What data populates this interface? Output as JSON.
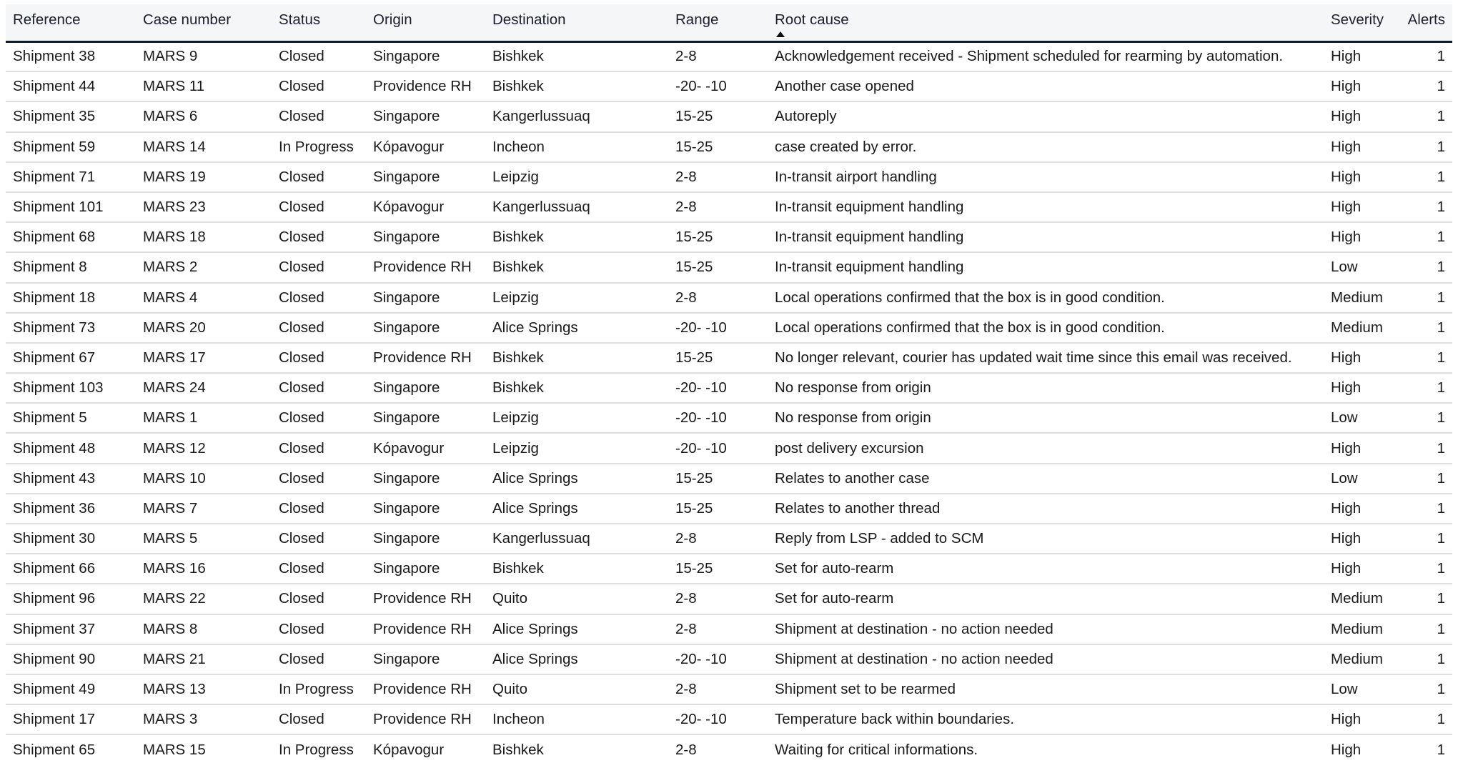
{
  "table": {
    "columns": [
      {
        "key": "reference",
        "label": "Reference"
      },
      {
        "key": "case_number",
        "label": "Case number"
      },
      {
        "key": "status",
        "label": "Status"
      },
      {
        "key": "origin",
        "label": "Origin"
      },
      {
        "key": "destination",
        "label": "Destination"
      },
      {
        "key": "range",
        "label": "Range"
      },
      {
        "key": "root_cause",
        "label": "Root cause",
        "sort": "ascending",
        "sort_icon": "sort-ascending-icon"
      },
      {
        "key": "severity",
        "label": "Severity"
      },
      {
        "key": "alerts",
        "label": "Alerts"
      }
    ],
    "rows": [
      {
        "reference": "Shipment 38",
        "case_number": "MARS 9",
        "status": "Closed",
        "origin": "Singapore",
        "destination": "Bishkek",
        "range": "2-8",
        "root_cause": "Acknowledgement received - Shipment scheduled for rearming by automation.",
        "severity": "High",
        "alerts": "1"
      },
      {
        "reference": "Shipment 44",
        "case_number": "MARS 11",
        "status": "Closed",
        "origin": "Providence RH",
        "destination": "Bishkek",
        "range": "-20- -10",
        "root_cause": "Another case opened",
        "severity": "High",
        "alerts": "1"
      },
      {
        "reference": "Shipment 35",
        "case_number": "MARS 6",
        "status": "Closed",
        "origin": "Singapore",
        "destination": "Kangerlussuaq",
        "range": "15-25",
        "root_cause": "Autoreply",
        "severity": "High",
        "alerts": "1"
      },
      {
        "reference": "Shipment 59",
        "case_number": "MARS 14",
        "status": "In Progress",
        "origin": "Kópavogur",
        "destination": "Incheon",
        "range": "15-25",
        "root_cause": "case created by error.",
        "severity": "High",
        "alerts": "1"
      },
      {
        "reference": "Shipment 71",
        "case_number": "MARS 19",
        "status": "Closed",
        "origin": "Singapore",
        "destination": "Leipzig",
        "range": "2-8",
        "root_cause": "In-transit airport handling",
        "severity": "High",
        "alerts": "1"
      },
      {
        "reference": "Shipment 101",
        "case_number": "MARS 23",
        "status": "Closed",
        "origin": "Kópavogur",
        "destination": "Kangerlussuaq",
        "range": "2-8",
        "root_cause": "In-transit equipment handling",
        "severity": "High",
        "alerts": "1"
      },
      {
        "reference": "Shipment 68",
        "case_number": "MARS 18",
        "status": "Closed",
        "origin": "Singapore",
        "destination": "Bishkek",
        "range": "15-25",
        "root_cause": "In-transit equipment handling",
        "severity": "High",
        "alerts": "1"
      },
      {
        "reference": "Shipment 8",
        "case_number": "MARS 2",
        "status": "Closed",
        "origin": "Providence RH",
        "destination": "Bishkek",
        "range": "15-25",
        "root_cause": "In-transit equipment handling",
        "severity": "Low",
        "alerts": "1"
      },
      {
        "reference": "Shipment 18",
        "case_number": "MARS 4",
        "status": "Closed",
        "origin": "Singapore",
        "destination": "Leipzig",
        "range": "2-8",
        "root_cause": "Local operations confirmed that the box is in good condition.",
        "severity": "Medium",
        "alerts": "1"
      },
      {
        "reference": "Shipment 73",
        "case_number": "MARS 20",
        "status": "Closed",
        "origin": "Singapore",
        "destination": "Alice Springs",
        "range": "-20- -10",
        "root_cause": "Local operations confirmed that the box is in good condition.",
        "severity": "Medium",
        "alerts": "1"
      },
      {
        "reference": "Shipment 67",
        "case_number": "MARS 17",
        "status": "Closed",
        "origin": "Providence RH",
        "destination": "Bishkek",
        "range": "15-25",
        "root_cause": "No longer relevant, courier has updated wait time since this email was received.",
        "severity": "High",
        "alerts": "1"
      },
      {
        "reference": "Shipment 103",
        "case_number": "MARS 24",
        "status": "Closed",
        "origin": "Singapore",
        "destination": "Bishkek",
        "range": "-20- -10",
        "root_cause": "No response from origin",
        "severity": "High",
        "alerts": "1"
      },
      {
        "reference": "Shipment 5",
        "case_number": "MARS 1",
        "status": "Closed",
        "origin": "Singapore",
        "destination": "Leipzig",
        "range": "-20- -10",
        "root_cause": "No response from origin",
        "severity": "Low",
        "alerts": "1"
      },
      {
        "reference": "Shipment 48",
        "case_number": "MARS 12",
        "status": "Closed",
        "origin": "Kópavogur",
        "destination": "Leipzig",
        "range": "-20- -10",
        "root_cause": "post delivery excursion",
        "severity": "High",
        "alerts": "1"
      },
      {
        "reference": "Shipment 43",
        "case_number": "MARS 10",
        "status": "Closed",
        "origin": "Singapore",
        "destination": "Alice Springs",
        "range": "15-25",
        "root_cause": "Relates to another case",
        "severity": "Low",
        "alerts": "1"
      },
      {
        "reference": "Shipment 36",
        "case_number": "MARS 7",
        "status": "Closed",
        "origin": "Singapore",
        "destination": "Alice Springs",
        "range": "15-25",
        "root_cause": "Relates to another thread",
        "severity": "High",
        "alerts": "1"
      },
      {
        "reference": "Shipment 30",
        "case_number": "MARS 5",
        "status": "Closed",
        "origin": "Singapore",
        "destination": "Kangerlussuaq",
        "range": "2-8",
        "root_cause": "Reply from LSP - added to SCM",
        "severity": "High",
        "alerts": "1"
      },
      {
        "reference": "Shipment 66",
        "case_number": "MARS 16",
        "status": "Closed",
        "origin": "Singapore",
        "destination": "Bishkek",
        "range": "15-25",
        "root_cause": "Set for auto-rearm",
        "severity": "High",
        "alerts": "1"
      },
      {
        "reference": "Shipment 96",
        "case_number": "MARS 22",
        "status": "Closed",
        "origin": "Providence RH",
        "destination": "Quito",
        "range": "2-8",
        "root_cause": "Set for auto-rearm",
        "severity": "Medium",
        "alerts": "1"
      },
      {
        "reference": "Shipment 37",
        "case_number": "MARS 8",
        "status": "Closed",
        "origin": "Providence RH",
        "destination": "Alice Springs",
        "range": "2-8",
        "root_cause": "Shipment at destination - no action needed",
        "severity": "Medium",
        "alerts": "1"
      },
      {
        "reference": "Shipment 90",
        "case_number": "MARS 21",
        "status": "Closed",
        "origin": "Singapore",
        "destination": "Alice Springs",
        "range": "-20- -10",
        "root_cause": "Shipment at destination - no action needed",
        "severity": "Medium",
        "alerts": "1"
      },
      {
        "reference": "Shipment 49",
        "case_number": "MARS 13",
        "status": "In Progress",
        "origin": "Providence RH",
        "destination": "Quito",
        "range": "2-8",
        "root_cause": "Shipment set to be rearmed",
        "severity": "Low",
        "alerts": "1"
      },
      {
        "reference": "Shipment 17",
        "case_number": "MARS 3",
        "status": "Closed",
        "origin": "Providence RH",
        "destination": "Incheon",
        "range": "-20- -10",
        "root_cause": "Temperature back within boundaries.",
        "severity": "High",
        "alerts": "1"
      },
      {
        "reference": "Shipment 65",
        "case_number": "MARS 15",
        "status": "In Progress",
        "origin": "Kópavogur",
        "destination": "Bishkek",
        "range": "2-8",
        "root_cause": "Waiting for critical informations.",
        "severity": "High",
        "alerts": "1"
      }
    ]
  },
  "colors": {
    "header_bg": "#f5f6f8",
    "header_border": "#141a2e",
    "row_divider": "#dedede",
    "text": "#1a1a1a"
  }
}
